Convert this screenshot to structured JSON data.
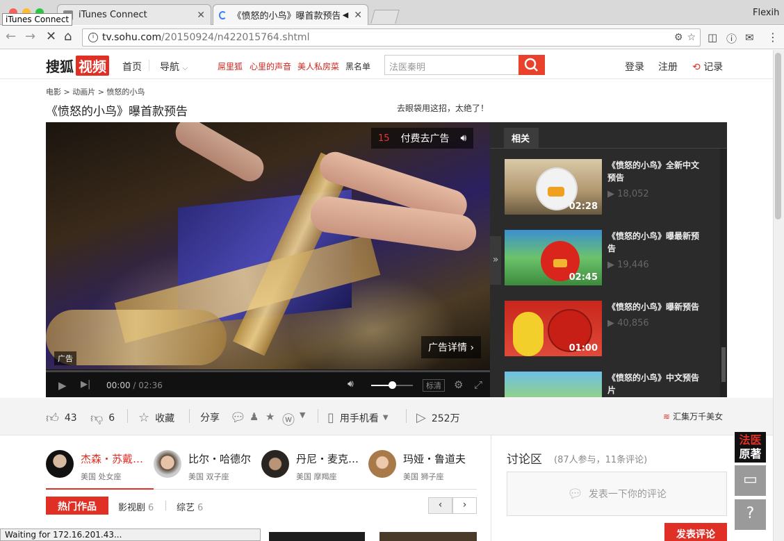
{
  "browser": {
    "tabs": [
      {
        "label": "iTunes Connect",
        "active": false
      },
      {
        "label": "《愤怒的小鸟》曝首款预告 -",
        "active": true
      }
    ],
    "profile": "Flexih",
    "tooltip": "iTunes Connect",
    "url_host": "tv.sohu.com",
    "url_path": "/20150924/n422015764.shtml",
    "status": "Waiting for 172.16.201.43..."
  },
  "header": {
    "logo_text": "搜狐",
    "logo_badge": "视频",
    "nav": [
      "首页",
      "导航"
    ],
    "red_links": [
      "屌里狐",
      "心里的声音",
      "美人私房菜"
    ],
    "blacklist": "黑名单",
    "search_placeholder": "法医秦明",
    "login": "登录",
    "register": "注册",
    "history": "记录"
  },
  "page": {
    "breadcrumb": "电影 > 动画片 > 愤怒的小鸟",
    "title": "《愤怒的小鸟》曝首款预告",
    "ad_text": "去眼袋用这招，太绝了！"
  },
  "player": {
    "ad_countdown": "15",
    "skip_ad": "付费去广告",
    "ad_details": "广告详情",
    "ad_badge": "广告",
    "current_time": "00:00",
    "total_time": "02:36",
    "quality": "标清",
    "progress_fraction": 0.0,
    "volume_fraction": 0.5
  },
  "related": {
    "tab": "相关",
    "items": [
      {
        "title": "《愤怒的小鸟》全新中文预告",
        "views": "18,052",
        "duration": "02:28"
      },
      {
        "title": "《愤怒的小鸟》曝最新预告",
        "views": "19,446",
        "duration": "02:45"
      },
      {
        "title": "《愤怒的小鸟》曝新预告",
        "views": "40,856",
        "duration": "01:00"
      },
      {
        "title": "《愤怒的小鸟》中文预告片",
        "views": "",
        "duration": ""
      }
    ]
  },
  "actions": {
    "likes": "43",
    "dislikes": "6",
    "favorite": "收藏",
    "share": "分享",
    "mobile": "用手机看",
    "plays": "252万",
    "promo": "汇集万千美女"
  },
  "cast": [
    {
      "name": "杰森・苏戴…",
      "info": "美国 处女座",
      "active": true
    },
    {
      "name": "比尔・哈德尔",
      "info": "美国 双子座",
      "active": false
    },
    {
      "name": "丹尼・麦克…",
      "info": "美国 摩羯座",
      "active": false
    },
    {
      "name": "玛娅・鲁道夫",
      "info": "美国 狮子座",
      "active": false
    }
  ],
  "works": {
    "hot": "热门作品",
    "tabs": [
      {
        "label": "影视剧",
        "count": "6"
      },
      {
        "label": "综艺",
        "count": "6"
      }
    ]
  },
  "discussion": {
    "title": "讨论区",
    "count": "(87人参与，11条评论)",
    "placeholder": "发表一下你的评论",
    "submit": "发表评论"
  },
  "side": {
    "ad_line1": "法医",
    "ad_line2": "原著"
  }
}
